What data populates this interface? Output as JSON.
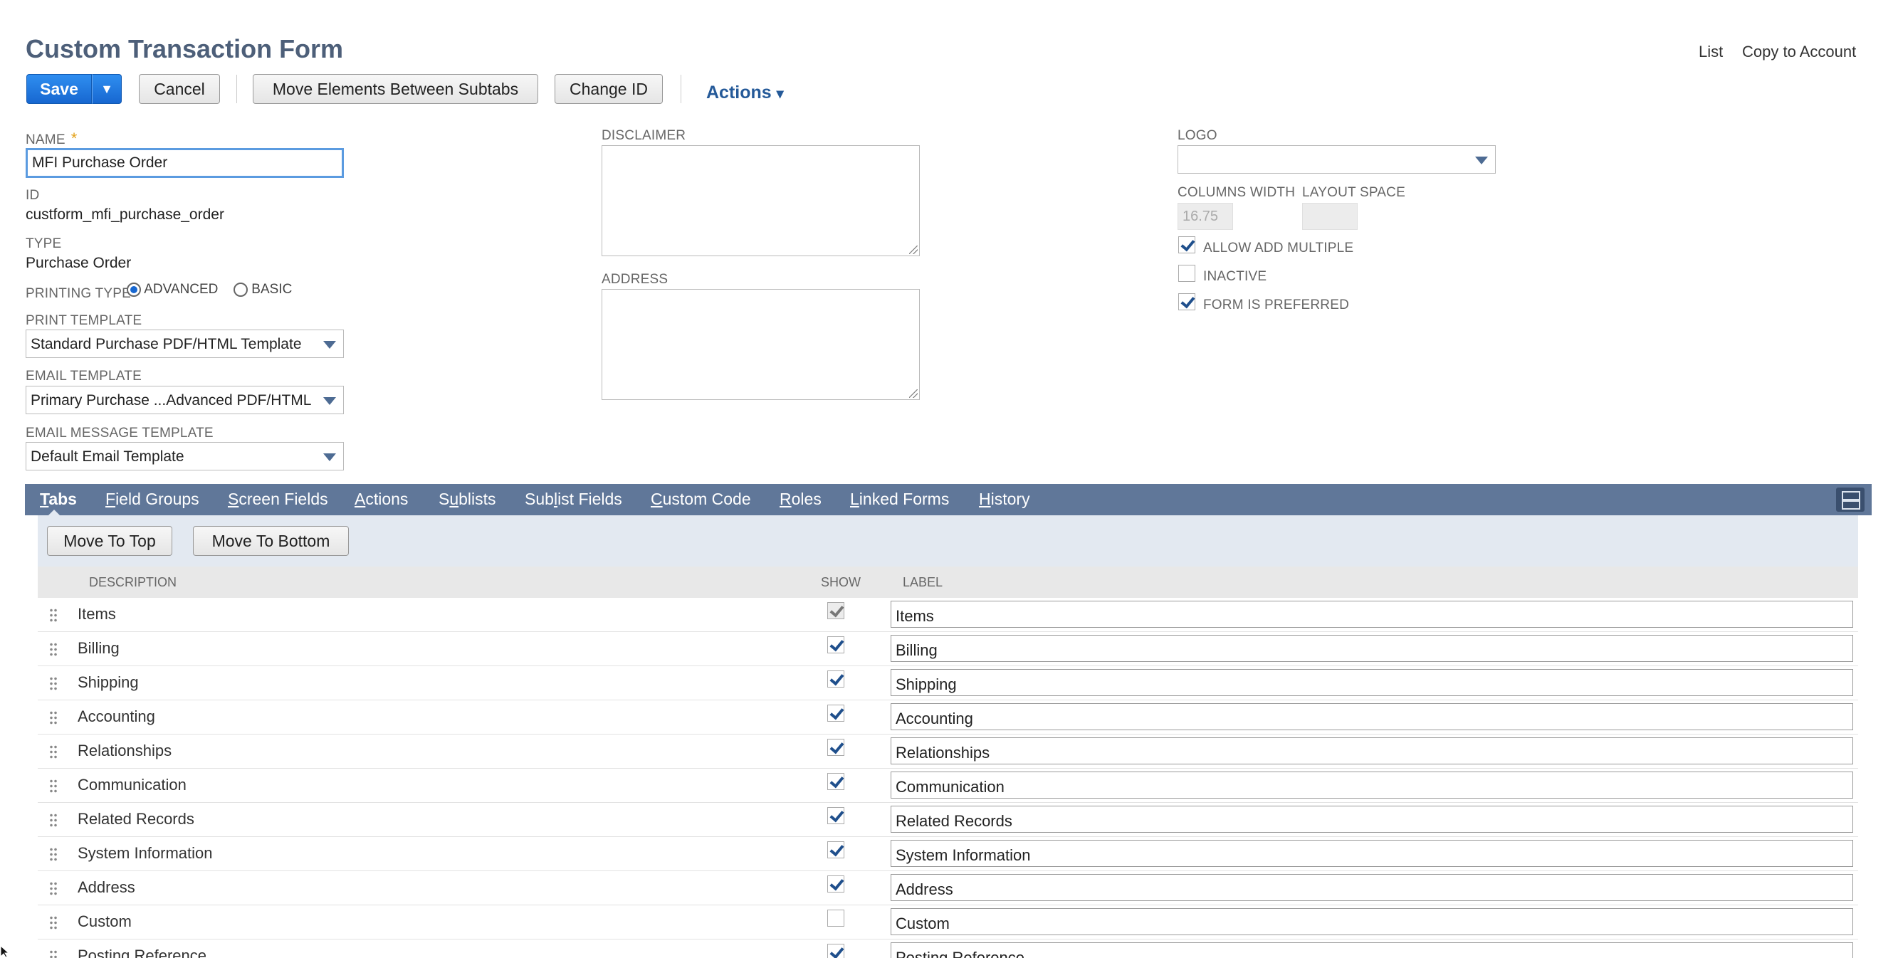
{
  "header": {
    "title": "Custom Transaction Form",
    "links": {
      "list": "List",
      "copy_to_account": "Copy to Account"
    }
  },
  "toolbar": {
    "save": "Save",
    "save_menu_arrow": "▼",
    "cancel": "Cancel",
    "move_elements": "Move Elements Between Subtabs",
    "change_id": "Change ID",
    "actions": "Actions",
    "actions_caret": "▾"
  },
  "form": {
    "name_label": "NAME",
    "name_required": "*",
    "name_value": "MFI Purchase Order",
    "id_label": "ID",
    "id_value": "custform_mfi_purchase_order",
    "type_label": "TYPE",
    "type_value": "Purchase Order",
    "printing_type_label": "PRINTING TYPE",
    "printing_advanced": "ADVANCED",
    "printing_basic": "BASIC",
    "printing_selected": "ADVANCED",
    "print_template_label": "PRINT TEMPLATE",
    "print_template_value": "Standard Purchase PDF/HTML Template",
    "email_template_label": "EMAIL TEMPLATE",
    "email_template_value": "Primary Purchase ...Advanced PDF/HTML",
    "email_message_template_label": "EMAIL MESSAGE TEMPLATE",
    "email_message_template_value": "Default Email Template",
    "disclaimer_label": "DISCLAIMER",
    "address_label": "ADDRESS",
    "logo_label": "LOGO",
    "logo_value": "",
    "columns_width_label": "COLUMNS WIDTH",
    "columns_width_value": "16.75",
    "layout_space_label": "LAYOUT SPACE",
    "layout_space_value": "",
    "allow_add_multiple_label": "ALLOW ADD MULTIPLE",
    "allow_add_multiple": true,
    "inactive_label": "INACTIVE",
    "inactive": false,
    "form_is_preferred_label": "FORM IS PREFERRED",
    "form_is_preferred": true
  },
  "tabs": [
    {
      "label": "Tabs",
      "access": "T",
      "rest": "abs",
      "active": true
    },
    {
      "label": "Field Groups",
      "access": "F",
      "rest": "ield Groups"
    },
    {
      "label": "Screen Fields",
      "access": "S",
      "rest": "creen Fields"
    },
    {
      "label": "Actions",
      "access": "A",
      "rest": "ctions"
    },
    {
      "label": "Sublists",
      "pre": "S",
      "access": "u",
      "rest": "blists"
    },
    {
      "label": "Sublist Fields",
      "pre": "Sub",
      "access": "l",
      "rest": "ist Fields"
    },
    {
      "label": "Custom Code",
      "access": "C",
      "rest": "ustom Code"
    },
    {
      "label": "Roles",
      "access": "R",
      "rest": "oles"
    },
    {
      "label": "Linked Forms",
      "access": "L",
      "rest": "inked Forms"
    },
    {
      "label": "History",
      "access": "H",
      "rest": "istory"
    }
  ],
  "subtab_buttons": {
    "move_to_top": "Move To Top",
    "move_to_bottom": "Move To Bottom"
  },
  "table": {
    "columns": {
      "description": "DESCRIPTION",
      "show": "SHOW",
      "label": "LABEL"
    },
    "rows": [
      {
        "description": "Items",
        "show": true,
        "locked": true,
        "label": "Items"
      },
      {
        "description": "Billing",
        "show": true,
        "label": "Billing"
      },
      {
        "description": "Shipping",
        "show": true,
        "label": "Shipping"
      },
      {
        "description": "Accounting",
        "show": true,
        "label": "Accounting"
      },
      {
        "description": "Relationships",
        "show": true,
        "label": "Relationships"
      },
      {
        "description": "Communication",
        "show": true,
        "label": "Communication"
      },
      {
        "description": "Related Records",
        "show": true,
        "label": "Related Records"
      },
      {
        "description": "System Information",
        "show": true,
        "label": "System Information"
      },
      {
        "description": "Address",
        "show": true,
        "label": "Address"
      },
      {
        "description": "Custom",
        "show": false,
        "label": "Custom"
      },
      {
        "description": "Posting Reference",
        "show": true,
        "label": "Posting Reference"
      }
    ]
  },
  "colors": {
    "accent": "#1767d0",
    "title": "#4d5f79",
    "tabbar": "#607799",
    "link": "#255a99"
  }
}
